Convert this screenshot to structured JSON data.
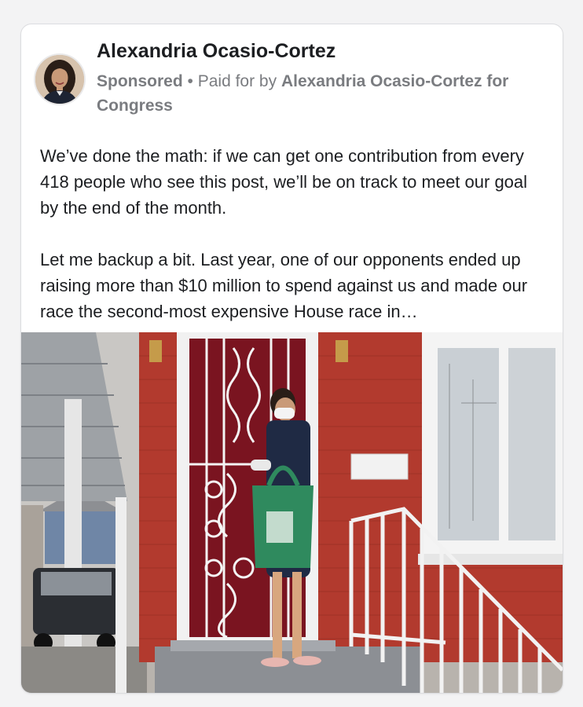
{
  "post": {
    "author": "Alexandria Ocasio-Cortez",
    "sponsored_label": "Sponsored",
    "separator": " • ",
    "paid_for_prefix": "Paid for by ",
    "paid_for_entity": "Alexandria Ocasio-Cortez for Congress",
    "paragraphs": [
      "We’ve done the math: if we can get one contribution from every 418 people who see this post, we’ll be on track to meet our goal by the end of the month.",
      "Let me backup a bit. Last year, one of our opponents ended up raising more than $10 million to spend against us and made our race the second-most expensive House race in…"
    ],
    "avatar_icon": "profile-photo",
    "photo_icon": "campaign-photo"
  },
  "colors": {
    "page_bg": "#f3f3f4",
    "card_bg": "#ffffff",
    "text": "#1c1e21",
    "meta_text": "#7a7c80",
    "brick": "#b23a2e",
    "door_red": "#7a1420",
    "bag_green": "#2f8a5e"
  }
}
